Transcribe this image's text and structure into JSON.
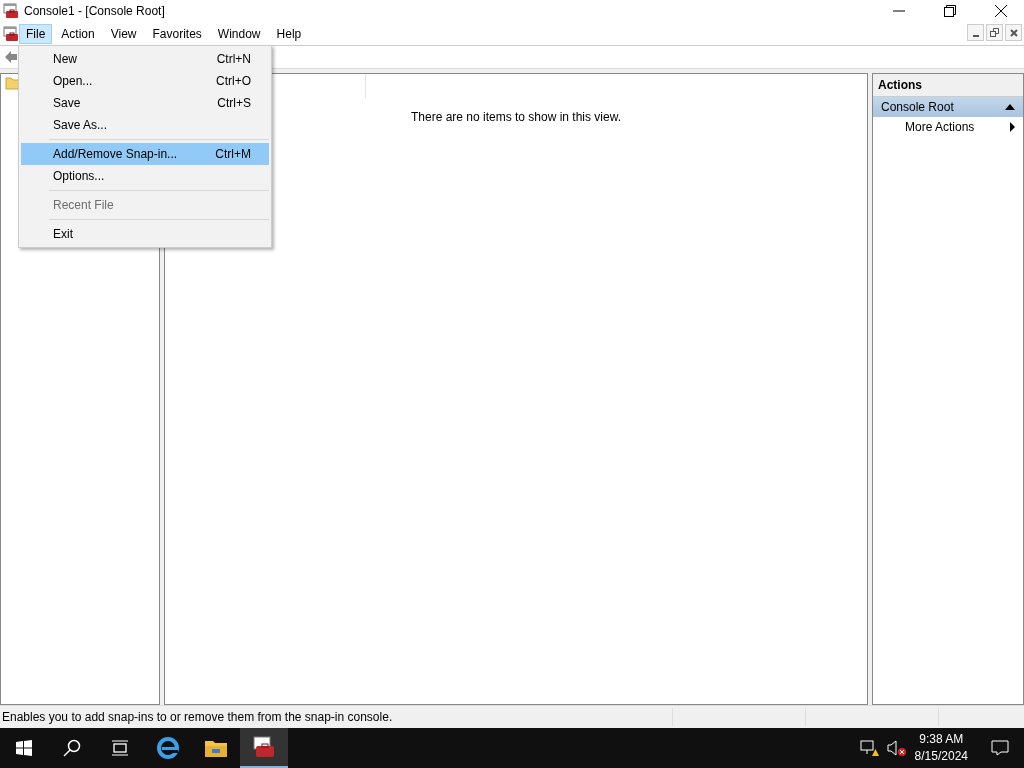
{
  "window": {
    "title": "Console1 - [Console Root]"
  },
  "menu_bar": [
    {
      "label": "File",
      "selected": true
    },
    {
      "label": "Action",
      "selected": false
    },
    {
      "label": "View",
      "selected": false
    },
    {
      "label": "Favorites",
      "selected": false
    },
    {
      "label": "Window",
      "selected": false
    },
    {
      "label": "Help",
      "selected": false
    }
  ],
  "file_menu": [
    {
      "kind": "item",
      "label": "New",
      "shortcut": "Ctrl+N",
      "selected": false,
      "disabled": false
    },
    {
      "kind": "item",
      "label": "Open...",
      "shortcut": "Ctrl+O",
      "selected": false,
      "disabled": false
    },
    {
      "kind": "item",
      "label": "Save",
      "shortcut": "Ctrl+S",
      "selected": false,
      "disabled": false
    },
    {
      "kind": "item",
      "label": "Save As...",
      "selected": false,
      "disabled": false
    },
    {
      "kind": "separator"
    },
    {
      "kind": "item",
      "label": "Add/Remove Snap-in...",
      "shortcut": "Ctrl+M",
      "selected": true,
      "disabled": false
    },
    {
      "kind": "item",
      "label": "Options...",
      "selected": false,
      "disabled": false
    },
    {
      "kind": "separator"
    },
    {
      "kind": "item",
      "label": "Recent File",
      "selected": false,
      "disabled": true
    },
    {
      "kind": "separator"
    },
    {
      "kind": "item",
      "label": "Exit",
      "selected": false,
      "disabled": false
    }
  ],
  "result_pane": {
    "empty_message": "There are no items to show in this view."
  },
  "actions_pane": {
    "title": "Actions",
    "section": "Console Root",
    "items": [
      {
        "label": "More Actions"
      }
    ]
  },
  "status_bar": {
    "text": "Enables you to add snap-ins to or remove them from the snap-in console."
  },
  "taskbar": {
    "time": "9:38 AM",
    "date": "8/15/2024"
  }
}
